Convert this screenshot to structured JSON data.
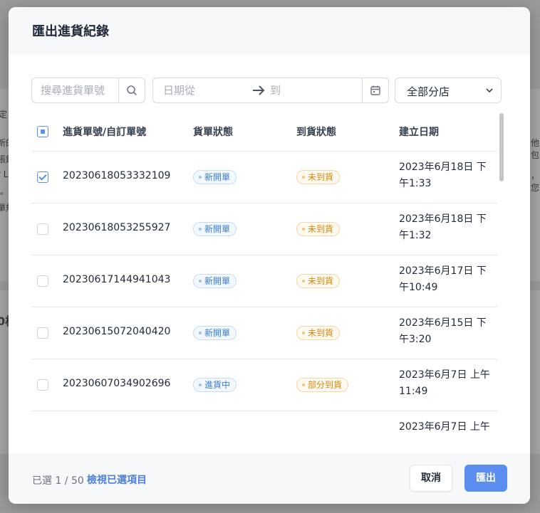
{
  "modal": {
    "title": "匯出進貨紀錄"
  },
  "toolbar": {
    "search_placeholder": "搜尋進貨單號",
    "date_from_placeholder": "日期從",
    "date_to_placeholder": "到",
    "store_filter": "全部分店"
  },
  "table": {
    "columns": [
      "進貨單號/自訂單號",
      "貨單狀態",
      "到貨狀態",
      "建立日期"
    ],
    "rows": [
      {
        "checked": true,
        "order_no": "20230618053332109",
        "order_status": "新開單",
        "arrival_status": "未到貨",
        "date_line1": "2023年6月18日 下",
        "date_line2": "午1:33"
      },
      {
        "checked": false,
        "order_no": "20230618053255927",
        "order_status": "新開單",
        "arrival_status": "未到貨",
        "date_line1": "2023年6月18日 下",
        "date_line2": "午1:32"
      },
      {
        "checked": false,
        "order_no": "20230617144941043",
        "order_status": "新開單",
        "arrival_status": "未到貨",
        "date_line1": "2023年6月17日 下",
        "date_line2": "午10:49"
      },
      {
        "checked": false,
        "order_no": "20230615072040420",
        "order_status": "新開單",
        "arrival_status": "未到貨",
        "date_line1": "2023年6月15日 下",
        "date_line2": "午3:20"
      },
      {
        "checked": false,
        "order_no": "20230607034902696",
        "order_status": "進貨中",
        "arrival_status": "部分到貨",
        "date_line1": "2023年6月7日 上午",
        "date_line2": "11:49"
      },
      {
        "checked": false,
        "order_no": "",
        "order_status": "",
        "arrival_status": "",
        "date_line1": "2023年6月7日 上午",
        "date_line2": ""
      }
    ]
  },
  "footer": {
    "selected_count": "已選 1 / 50",
    "view_selected": "檢視已選項目",
    "cancel_label": "取消",
    "export_label": "匯出"
  },
  "background": {
    "fragments": [
      "定",
      "新的",
      "張鉢",
      "r Li",
      "。",
      "單規",
      "他包",
      "，您",
      "0核"
    ]
  },
  "colors": {
    "accent": "#5b8def",
    "status_blue": "#3b7dd8",
    "status_orange": "#d4870f"
  }
}
